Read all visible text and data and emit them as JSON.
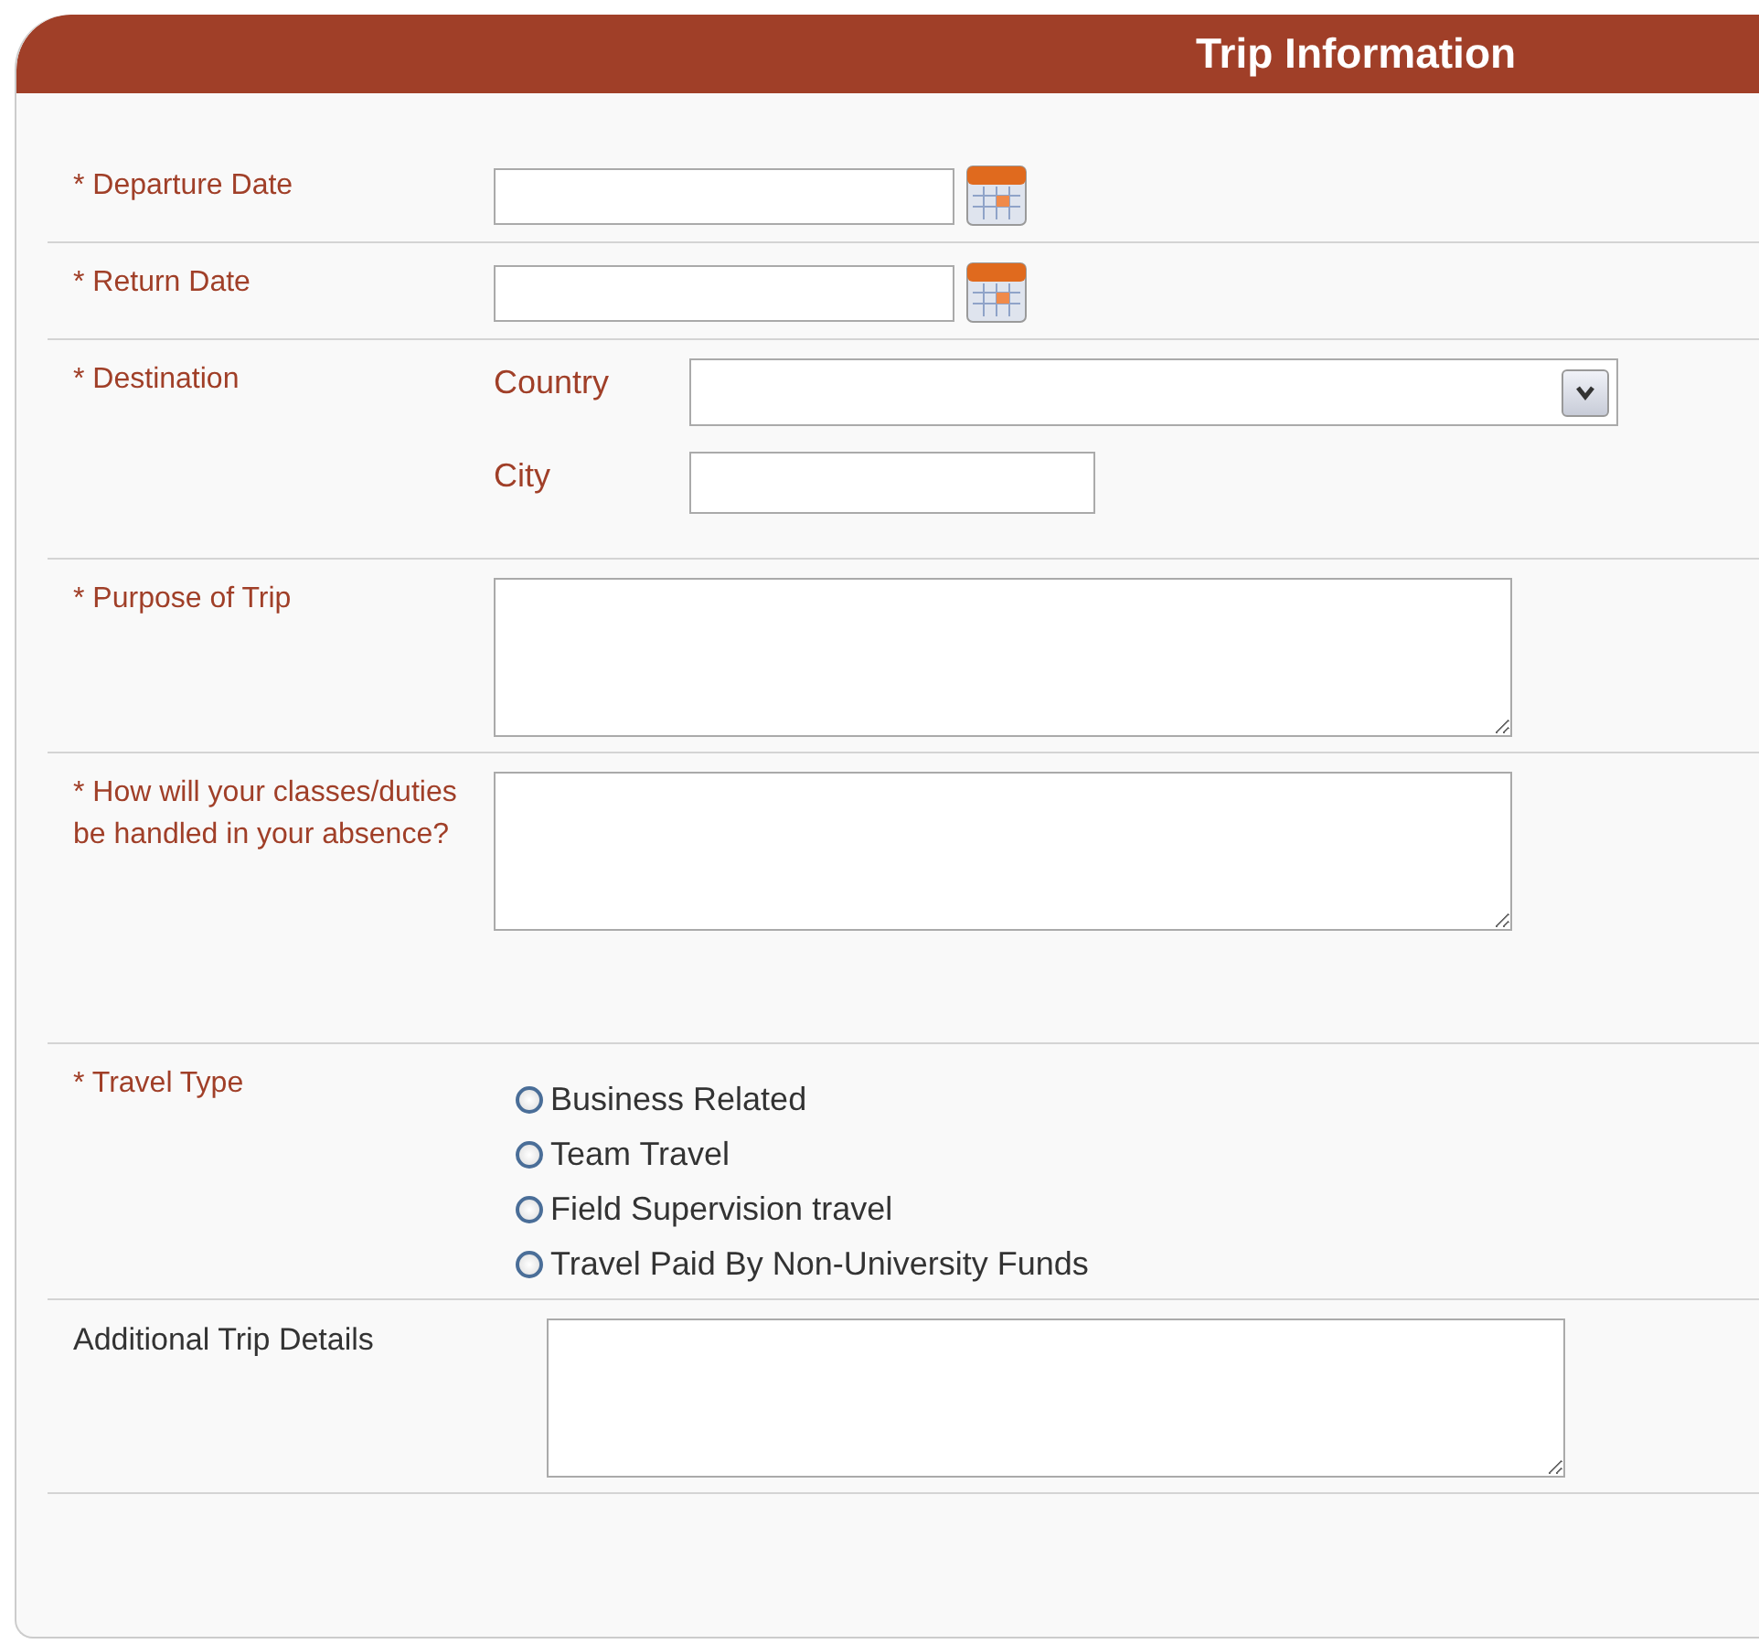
{
  "panel": {
    "title": "Trip Information"
  },
  "rows": [
    {
      "kind": "date",
      "label": "* Departure Date",
      "required": true
    },
    {
      "kind": "date",
      "label": "* Return Date",
      "required": true
    },
    {
      "kind": "destination",
      "label": "* Destination",
      "required": true,
      "country_label": "Country",
      "city_label": "City"
    },
    {
      "kind": "textarea",
      "label": "* Purpose of Trip",
      "required": true
    },
    {
      "kind": "textarea",
      "label": "* How will your classes/duties be handled in your absence?",
      "required": true,
      "tall": true
    },
    {
      "kind": "radio",
      "label": "* Travel Type",
      "required": true,
      "options": [
        {
          "label": "Business Related",
          "selected": false
        },
        {
          "label": "Team Travel",
          "selected": false
        },
        {
          "label": "Field Supervision travel",
          "selected": false
        },
        {
          "label": "Travel Paid By Non-University Funds",
          "selected": false
        }
      ]
    },
    {
      "kind": "textarea",
      "label": "Additional Trip Details",
      "required": false,
      "wide_label": true
    }
  ]
}
